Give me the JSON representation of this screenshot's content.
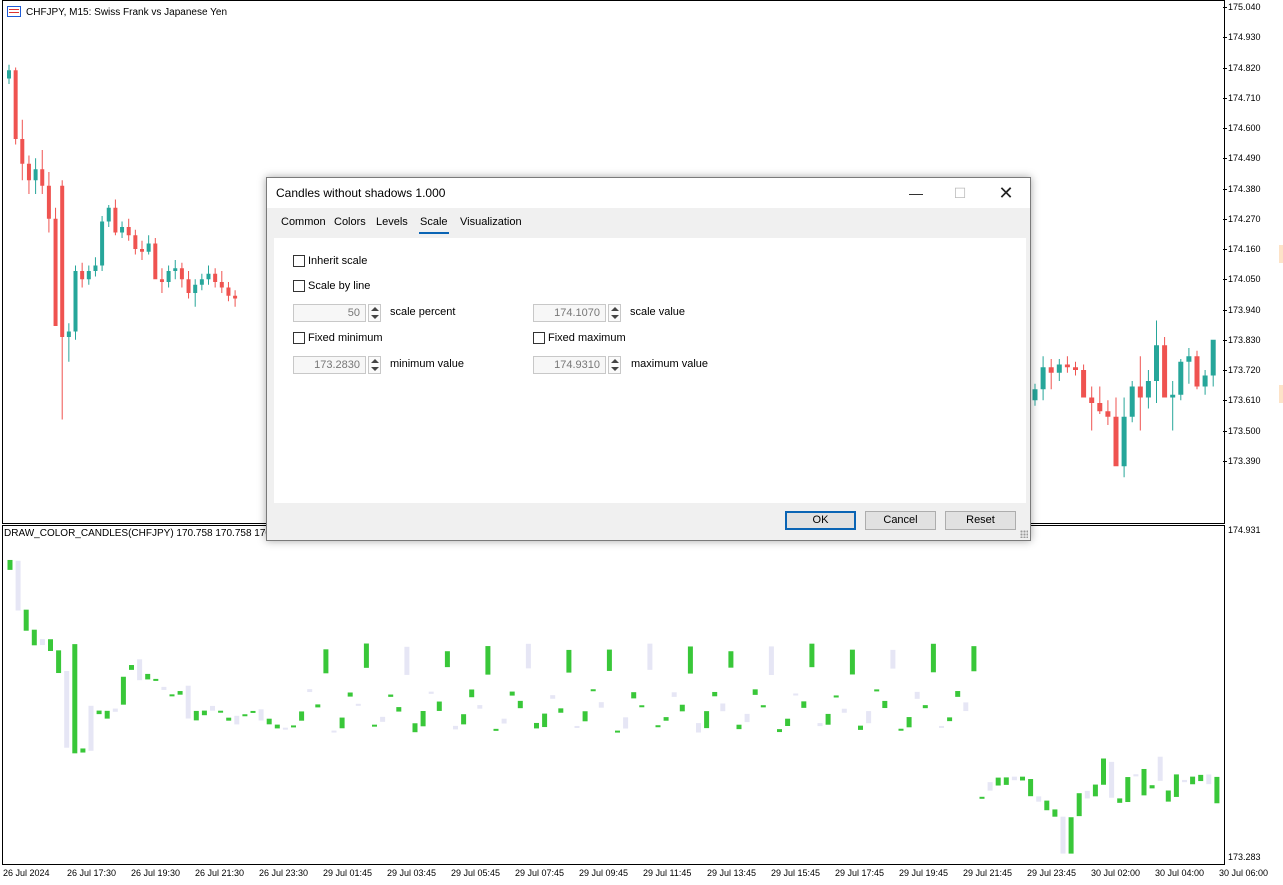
{
  "main_chart": {
    "title": "CHFJPY, M15:  Swiss Frank vs Japanese Yen",
    "icon": "symbol-chart-icon",
    "price_labels": [
      "175.040",
      "174.930",
      "174.820",
      "174.710",
      "174.600",
      "174.490",
      "174.380",
      "174.270",
      "174.160",
      "174.050",
      "173.940",
      "173.830",
      "173.720",
      "173.610",
      "173.500",
      "173.390"
    ],
    "price_range": [
      173.28,
      175.04
    ],
    "bull_color": "#26a69a",
    "bear_color": "#ef5350",
    "candles": [
      [
        174.78,
        174.83,
        174.76,
        174.81
      ],
      [
        174.81,
        174.82,
        174.54,
        174.56
      ],
      [
        174.56,
        174.63,
        174.41,
        174.47
      ],
      [
        174.47,
        174.5,
        174.36,
        174.41
      ],
      [
        174.41,
        174.49,
        174.36,
        174.45
      ],
      [
        174.45,
        174.52,
        174.36,
        174.39
      ],
      [
        174.39,
        174.44,
        174.22,
        174.27
      ],
      [
        174.27,
        174.31,
        173.88,
        173.88
      ],
      [
        174.39,
        174.41,
        173.54,
        173.84
      ],
      [
        173.84,
        173.89,
        173.75,
        173.86
      ],
      [
        173.86,
        174.1,
        173.83,
        174.08
      ],
      [
        174.08,
        174.11,
        174.02,
        174.05
      ],
      [
        174.05,
        174.1,
        174.03,
        174.08
      ],
      [
        174.08,
        174.13,
        174.06,
        174.1
      ],
      [
        174.1,
        174.28,
        174.08,
        174.26
      ],
      [
        174.26,
        174.32,
        174.24,
        174.31
      ],
      [
        174.31,
        174.34,
        174.21,
        174.22
      ],
      [
        174.22,
        174.26,
        174.2,
        174.24
      ],
      [
        174.24,
        174.27,
        174.19,
        174.21
      ],
      [
        174.21,
        174.23,
        174.14,
        174.16
      ],
      [
        174.16,
        174.19,
        174.12,
        174.15
      ],
      [
        174.15,
        174.21,
        174.14,
        174.18
      ],
      [
        174.18,
        174.2,
        174.07,
        174.05
      ],
      [
        174.05,
        174.09,
        174.0,
        174.04
      ],
      [
        174.04,
        174.1,
        174.02,
        174.08
      ],
      [
        174.08,
        174.12,
        174.05,
        174.09
      ],
      [
        174.09,
        174.11,
        174.02,
        174.05
      ],
      [
        174.05,
        174.08,
        173.98,
        174.0
      ],
      [
        174.0,
        174.05,
        173.95,
        174.03
      ],
      [
        174.03,
        174.07,
        174.01,
        174.05
      ],
      [
        174.05,
        174.1,
        174.03,
        174.07
      ],
      [
        174.07,
        174.09,
        174.02,
        174.04
      ],
      [
        174.04,
        174.08,
        174.0,
        174.02
      ],
      [
        174.02,
        174.04,
        173.97,
        173.99
      ],
      [
        173.99,
        174.01,
        173.95,
        173.98
      ]
    ],
    "candles_right": [
      [
        173.61,
        173.67,
        173.59,
        173.65
      ],
      [
        173.65,
        173.77,
        173.61,
        173.73
      ],
      [
        173.73,
        173.76,
        173.65,
        173.71
      ],
      [
        173.71,
        173.76,
        173.68,
        173.74
      ],
      [
        173.74,
        173.77,
        173.71,
        173.73
      ],
      [
        173.73,
        173.75,
        173.7,
        173.72
      ],
      [
        173.72,
        173.74,
        173.65,
        173.62
      ],
      [
        173.62,
        173.66,
        173.5,
        173.6
      ],
      [
        173.6,
        173.66,
        173.56,
        173.57
      ],
      [
        173.57,
        173.61,
        173.52,
        173.55
      ],
      [
        173.55,
        173.62,
        173.43,
        173.37
      ],
      [
        173.37,
        173.62,
        173.33,
        173.55
      ],
      [
        173.55,
        173.68,
        173.53,
        173.66
      ],
      [
        173.66,
        173.77,
        173.5,
        173.62
      ],
      [
        173.62,
        173.72,
        173.58,
        173.68
      ],
      [
        173.68,
        173.9,
        173.6,
        173.81
      ],
      [
        173.81,
        173.84,
        173.64,
        173.62
      ],
      [
        173.62,
        173.68,
        173.5,
        173.63
      ],
      [
        173.63,
        173.76,
        173.61,
        173.75
      ],
      [
        173.75,
        173.8,
        173.67,
        173.77
      ],
      [
        173.77,
        173.79,
        173.65,
        173.66
      ],
      [
        173.66,
        173.72,
        173.63,
        173.7
      ],
      [
        173.7,
        173.79,
        173.66,
        173.83
      ]
    ]
  },
  "sub_chart": {
    "title": "DRAW_COLOR_CANDLES(CHFJPY) 170.758 170.758 170.72",
    "price_labels": [
      "174.931",
      "173.283"
    ],
    "range": [
      173.283,
      174.931
    ],
    "green_color": "#39c739",
    "pale_color": "#e6e6f5"
  },
  "time_labels": [
    "26 Jul 2024",
    "26 Jul 17:30",
    "26 Jul 19:30",
    "26 Jul 21:30",
    "26 Jul 23:30",
    "29 Jul 01:45",
    "29 Jul 03:45",
    "29 Jul 05:45",
    "29 Jul 07:45",
    "29 Jul 09:45",
    "29 Jul 11:45",
    "29 Jul 13:45",
    "29 Jul 15:45",
    "29 Jul 17:45",
    "29 Jul 19:45",
    "29 Jul 21:45",
    "29 Jul 23:45",
    "30 Jul 02:00",
    "30 Jul 04:00",
    "30 Jul 06:00"
  ],
  "dialog": {
    "title": "Candles without shadows 1.000",
    "tabs": [
      "Common",
      "Colors",
      "Levels",
      "Scale",
      "Visualization"
    ],
    "active_tab": "Scale",
    "inherit_scale_label": "Inherit scale",
    "scale_by_line_label": "Scale by line",
    "scale_percent_value": "50",
    "scale_percent_label": "scale percent",
    "scale_value_value": "174.1070",
    "scale_value_label": "scale value",
    "fixed_minimum_label": "Fixed minimum",
    "fixed_maximum_label": "Fixed maximum",
    "minimum_value_value": "173.2830",
    "minimum_value_label": "minimum value",
    "maximum_value_value": "174.9310",
    "maximum_value_label": "maximum value",
    "ok_label": "OK",
    "cancel_label": "Cancel",
    "reset_label": "Reset"
  }
}
